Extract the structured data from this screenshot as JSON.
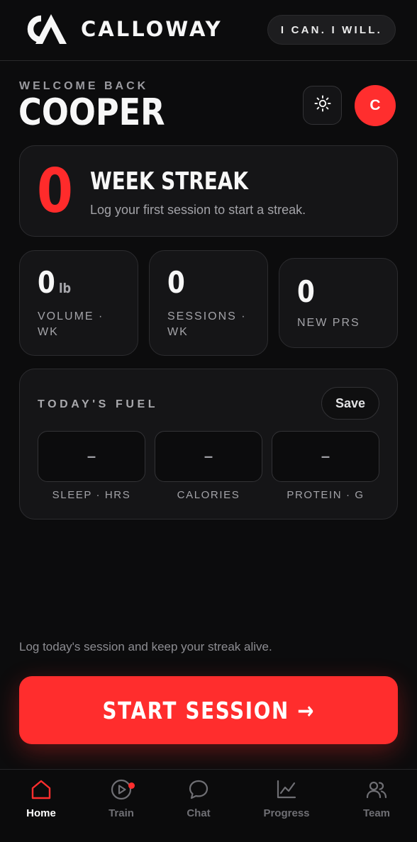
{
  "header": {
    "brand_name": "CALLOWAY",
    "logo": "ca-monogram-logo",
    "motto": "I CAN. I WILL."
  },
  "welcome": {
    "label": "WELCOME BACK",
    "name": "COOPER",
    "theme_icon": "sun-icon",
    "avatar_initial": "C"
  },
  "streak": {
    "count": "0",
    "title": "WEEK STREAK",
    "subtitle": "Log your first session to start a streak."
  },
  "stats": [
    {
      "value": "0",
      "unit": "lb",
      "label": "VOLUME · WK"
    },
    {
      "value": "0",
      "unit": "",
      "label": "SESSIONS · WK"
    },
    {
      "value": "0",
      "unit": "",
      "label": "NEW PRS"
    }
  ],
  "fuel": {
    "title": "TODAY'S FUEL",
    "save_label": "Save",
    "fields": [
      {
        "value": "–",
        "label": "SLEEP · HRS"
      },
      {
        "value": "–",
        "label": "CALORIES"
      },
      {
        "value": "–",
        "label": "PROTEIN · G"
      }
    ]
  },
  "cta": {
    "hint": "Log today's session and keep your streak alive.",
    "button_label": "START SESSION →"
  },
  "nav": {
    "items": [
      {
        "label": "Home",
        "icon": "home-icon",
        "active": true
      },
      {
        "label": "Train",
        "icon": "play-circle-icon",
        "active": false
      },
      {
        "label": "Chat",
        "icon": "chat-bubble-icon",
        "active": false
      },
      {
        "label": "Progress",
        "icon": "trend-line-icon",
        "active": false
      },
      {
        "label": "Team",
        "icon": "users-icon",
        "active": false
      }
    ]
  },
  "colors": {
    "accent": "#ff2e2e",
    "background": "#0c0c0d",
    "card": "#151517",
    "muted_text": "#a3a3a8"
  }
}
